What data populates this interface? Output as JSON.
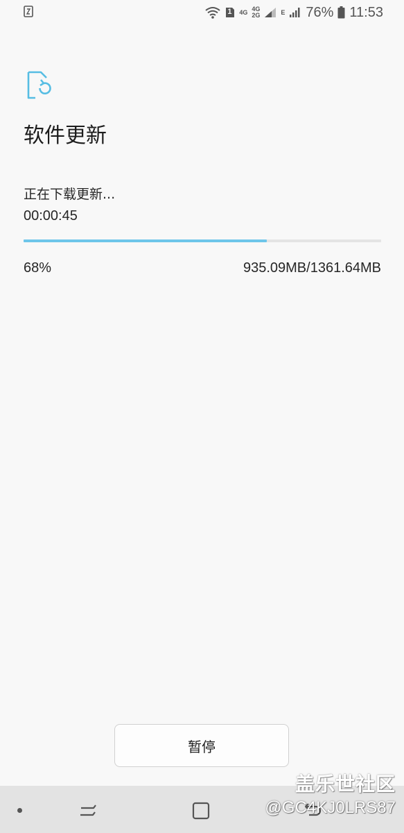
{
  "status_bar": {
    "sim_badge": "1",
    "network_4g": "4G",
    "network_4g_top": "4G",
    "network_2g_bottom": "2G",
    "network_e": "E",
    "battery_percent": "76%",
    "time": "11:53",
    "icons": [
      "screenshot-icon",
      "wifi-icon",
      "sim-icon",
      "signal-icon",
      "battery-icon"
    ]
  },
  "header": {
    "icon": "software-update-icon",
    "title": "软件更新"
  },
  "download": {
    "status": "正在下载更新...",
    "elapsed": "00:00:45",
    "progress": 0.68,
    "percent_label": "68%",
    "size_label": "935.09MB/1361.64MB"
  },
  "actions": {
    "pause_label": "暂停"
  },
  "nav_bar": {
    "icons": [
      "recent-apps-icon",
      "home-icon",
      "back-icon"
    ]
  },
  "watermark": {
    "title": "盖乐世社区",
    "handle": "@GC4KJ0LRS87"
  },
  "colors": {
    "accent": "#6ec6ea",
    "background": "#f8f8f8",
    "nav_background": "#e3e3e3"
  }
}
